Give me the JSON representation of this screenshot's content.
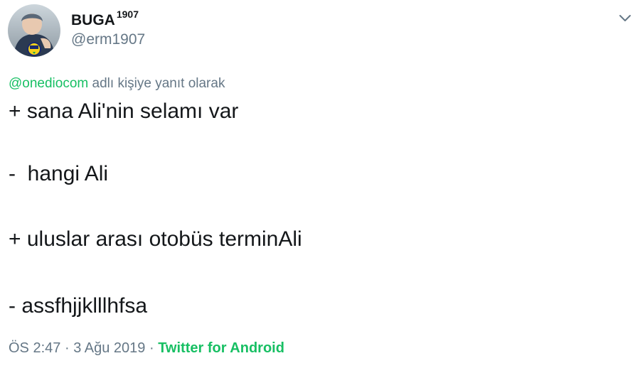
{
  "author": {
    "display_name": "BUGA",
    "display_name_sup": "1907",
    "handle": "@erm1907"
  },
  "reply_context": {
    "mention": "@onediocom",
    "suffix": "adlı kişiye yanıt olarak"
  },
  "tweet_lines": [
    "+ sana Ali'nin selamı var",
    "-  hangi Ali",
    "+ uluslar arası otobüs terminAli",
    "- assfhjjklllhfsa"
  ],
  "meta": {
    "time": "ÖS 2:47",
    "separator": "·",
    "date": "3 Ağu 2019",
    "source": "Twitter for Android"
  },
  "colors": {
    "accent_green": "#17bf63",
    "muted_gray": "#657786",
    "text": "#14171a"
  },
  "icons": {
    "menu": "chevron-down-icon",
    "badge": "team-crest-icon"
  }
}
